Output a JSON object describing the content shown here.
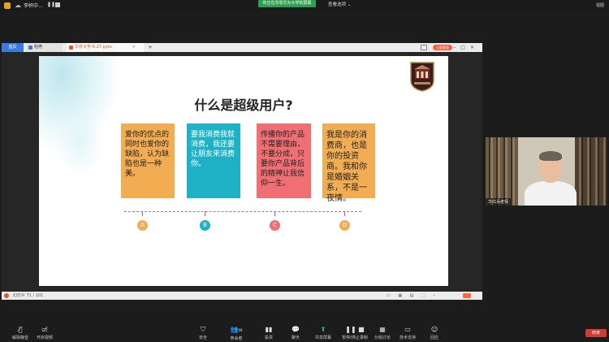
{
  "topbar": {
    "meeting_title": "李帜中...",
    "share_banner": "你正在共享华为大学的屏幕",
    "view_options": "查看选项 ⌄",
    "view_button": "视图"
  },
  "wps": {
    "tabs": {
      "home": "首页",
      "daoke": "稻壳",
      "doc": "华侨大学-6.27.pptx"
    },
    "login": "立即登录",
    "status": {
      "pages": "幻灯片 71 / 101"
    }
  },
  "slide": {
    "title": "什么是超级用户?",
    "cards": [
      {
        "letter": "A",
        "text": "爱你的优点的同时也爱你的缺陷，认为缺陷也是一种美。"
      },
      {
        "letter": "B",
        "text": "要我消费我就消费，我还要让朋友来消费你。"
      },
      {
        "letter": "C",
        "text": "传播你的产品不需要理由，不要分成，只要你产品背后的精神让我信仰一生。"
      },
      {
        "letter": "D",
        "text": "我是你的消费商，也是你的投资商。我和你是婚姻关系，不是一夜情。"
      }
    ]
  },
  "webcam": {
    "name": "华红兵老师"
  },
  "toolbar": {
    "items": [
      {
        "icon": "mic-muted-icon",
        "label": "解除静音"
      },
      {
        "icon": "video-icon",
        "label": "开启视频"
      },
      {
        "icon": "shield-icon",
        "label": "安全"
      },
      {
        "icon": "participants-icon",
        "label": "参会者",
        "count": "68"
      },
      {
        "icon": "poll-icon",
        "label": "投票"
      },
      {
        "icon": "chat-icon",
        "label": "聊天"
      },
      {
        "icon": "share-screen-icon",
        "label": "共享屏幕"
      },
      {
        "icon": "record-icon",
        "label": "暂停/停止录制"
      },
      {
        "icon": "breakout-icon",
        "label": "分组讨论"
      },
      {
        "icon": "support-icon",
        "label": "技术支持"
      },
      {
        "icon": "reaction-icon",
        "label": "回应"
      }
    ],
    "end": "结束"
  },
  "colors": {
    "orange": "#f2ad52",
    "teal": "#1fb2c6",
    "red": "#ef6f73",
    "share_green": "#2fa052",
    "end_red": "#d33a32"
  }
}
